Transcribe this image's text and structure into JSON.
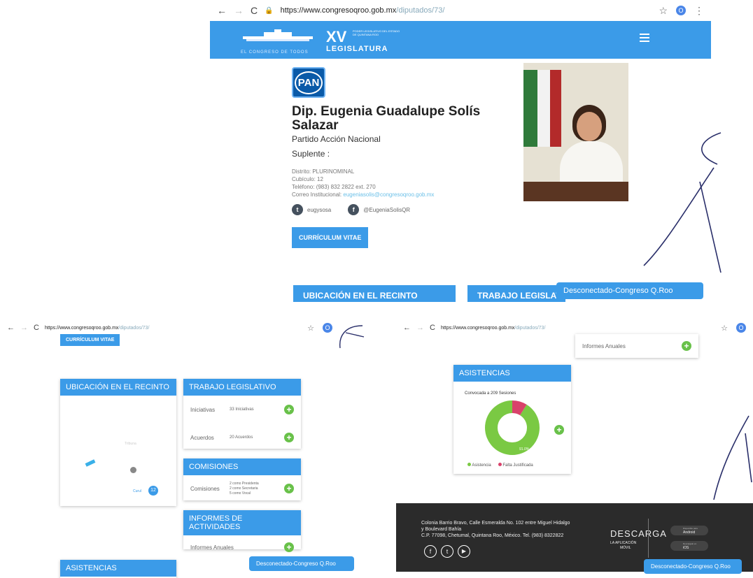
{
  "top": {
    "url_domain": "https://www.congresoqroo.gob.mx",
    "url_path": "/diputados/73/",
    "user_initial": "O",
    "header": {
      "logo_caption": "EL CONGRESO DE TODOS",
      "legislatura_numeral": "XV",
      "legislatura_small": "PODER LEGISLATIVO DEL ESTADO DE QUINTANA ROO",
      "legislatura_label": "LEGISLATURA"
    },
    "party_logo": "PAN",
    "name": "Dip. Eugenia Guadalupe Solís Salazar",
    "party": "Partido Acción Nacional",
    "suplente": "Suplente :",
    "distrito": "Distrito: PLURINOMINAL",
    "cubiculo": "Cubículo: 12",
    "telefono": "Teléfono: (983) 832 2822 ext. 270",
    "correo_label": "Correo Institucional:",
    "correo_value": "eugeniasolis@congresoqroo.gob.mx",
    "twitter": "eugysosa",
    "facebook": "@EugeniaSolisQR",
    "cv_button": "CURRÍCULUM VITAE",
    "tab_ubicacion": "UBICACIÓN EN EL RECINTO",
    "tab_trabajo": "TRABAJO LEGISLAT",
    "toast": "Desconectado-Congreso Q.Roo"
  },
  "bottom_left": {
    "url_domain": "https://www.congresoqroo.gob.mx",
    "url_path": "/diputados/73/",
    "user_initial": "O",
    "cv_button": "CURRÍCULUM VITAE",
    "ubicacion_title": "UBICACIÓN EN EL RECINTO",
    "map_label": "Tribuna",
    "curul_label": "Curul",
    "curul_number": "12",
    "trabajo_title": "TRABAJO LEGISLATIVO",
    "iniciativas_label": "Iniciativas",
    "iniciativas_value": "33 Iniciativas",
    "acuerdos_label": "Acuerdos",
    "acuerdos_value": "20 Acuerdos",
    "comisiones_title": "COMISIONES",
    "comisiones_label": "Comisiones",
    "comisiones_lines": [
      "2 como Presidenta",
      "2 como Secretaria",
      "5 como Vocal"
    ],
    "informes_title": "INFORMES DE ACTIVIDADES",
    "informes_label": "Informes Anuales",
    "asistencias_title": "ASISTENCIAS",
    "toast": "Desconectado-Congreso Q.Roo"
  },
  "bottom_right": {
    "url_domain": "https://www.congresoqroo.gob.mx",
    "url_path": "/diputados/73/",
    "user_initial": "O",
    "informes_label": "Informes Anuales",
    "asistencias_title": "ASISTENCIAS",
    "convocada": "Convocada a 209 Sesiones",
    "donut_label": "91.0%",
    "legend_asistencia": "Asistencia",
    "legend_falta": "Falta Justificada",
    "footer_address_1": "Colonia Barrio Bravo, Calle Esmeralda No. 102 entre Miguel Hidalgo",
    "footer_address_2": "y Boulevard Bahía",
    "footer_address_3": "C.P. 77098, Chetumal, Quintana Roo, México. Tel. (983) 8322822",
    "descarga": "DESCARGA",
    "app_line1": "LA APLICACIÓN",
    "app_line2": "MÓVIL",
    "android_small": "Disponible para",
    "android": "Android",
    "ios_small": "Descargalo en",
    "ios": "iOS",
    "toast": "Desconectado-Congreso Q.Roo"
  },
  "chart_data": {
    "type": "pie",
    "title": "Convocada a 209 Sesiones",
    "categories": [
      "Asistencia",
      "Falta Justificada"
    ],
    "values": [
      91.0,
      9.0
    ],
    "colors": [
      "#7ac943",
      "#d9426b"
    ]
  },
  "colors": {
    "brand_blue": "#3b9be8",
    "green": "#69c14a",
    "footer": "#2b2b2b"
  }
}
